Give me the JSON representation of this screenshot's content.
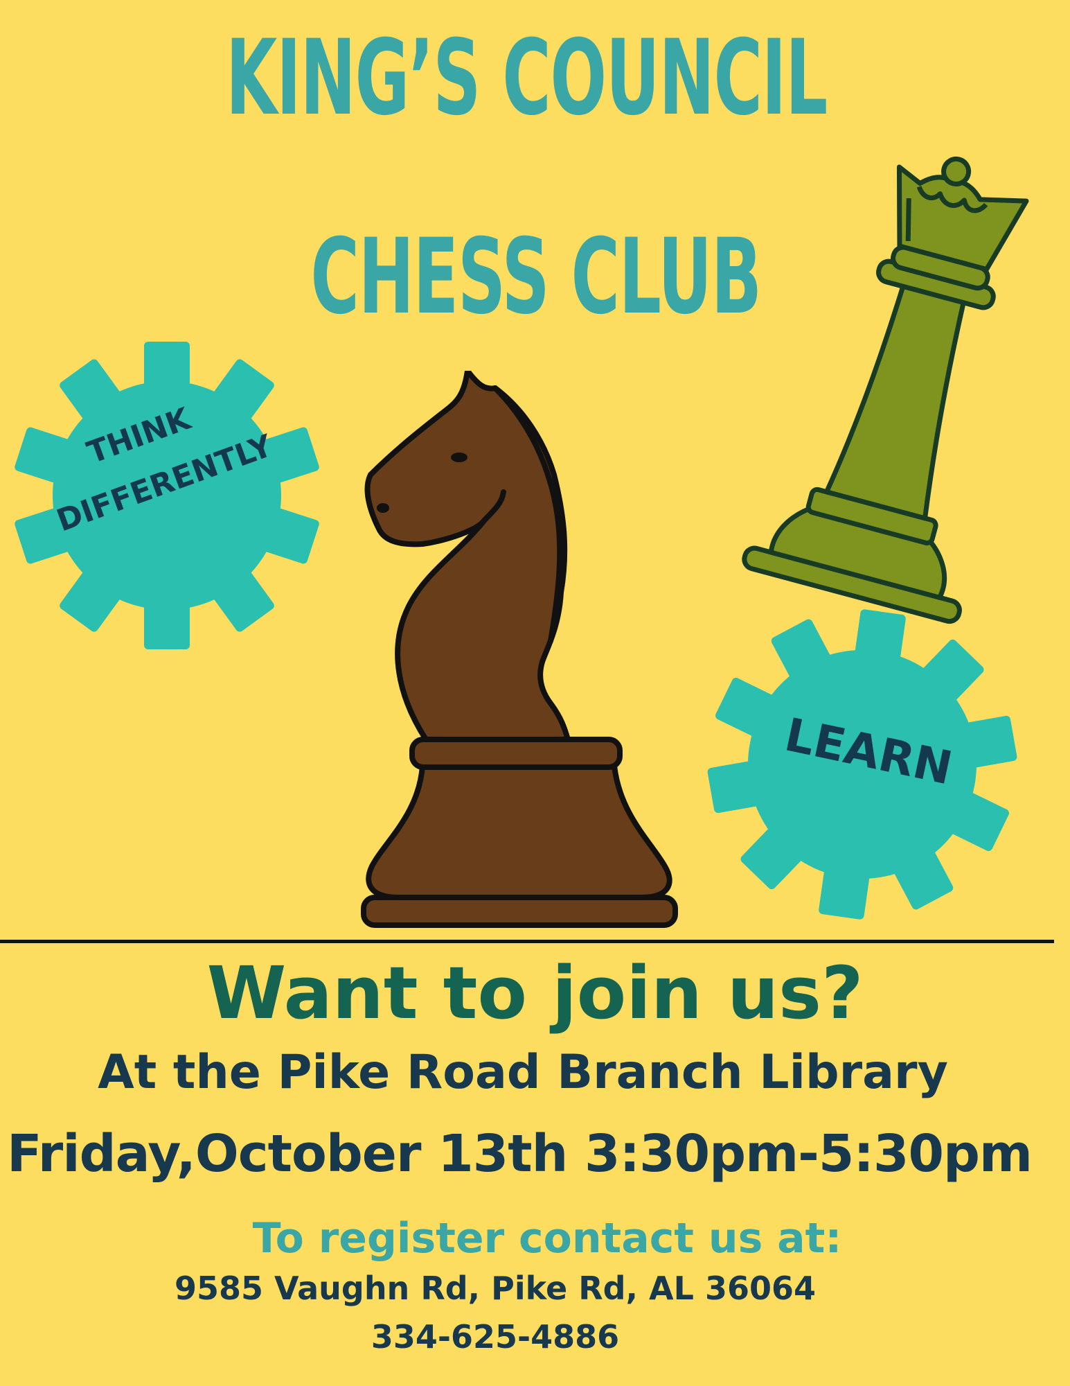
{
  "poster": {
    "title_line1": "KING’S COUNCIL",
    "title_line2": "CHESS CLUB",
    "badge_left": {
      "line1": "THINK",
      "line2": "DIFFERENTLY"
    },
    "badge_right": "LEARN",
    "headline": "Want to join us?",
    "location": "At the Pike Road Branch Library",
    "datetime": "Friday,October 13th 3:30pm-5:30pm",
    "register_prompt": "To register contact us at:",
    "address": "9585 Vaughn Rd, Pike Rd, AL 36064",
    "phone": "334-625-4886"
  },
  "colors": {
    "background": "#FDDD5F",
    "title": "#3AA6A5",
    "gear": "#2ABFAE",
    "knight": "#683D1A",
    "queen": "#7E941E",
    "headline": "#156451",
    "text_dark": "#17384D"
  },
  "icons": {
    "knight": "chess-knight-icon",
    "queen": "chess-queen-icon",
    "gear": "gear-icon"
  }
}
